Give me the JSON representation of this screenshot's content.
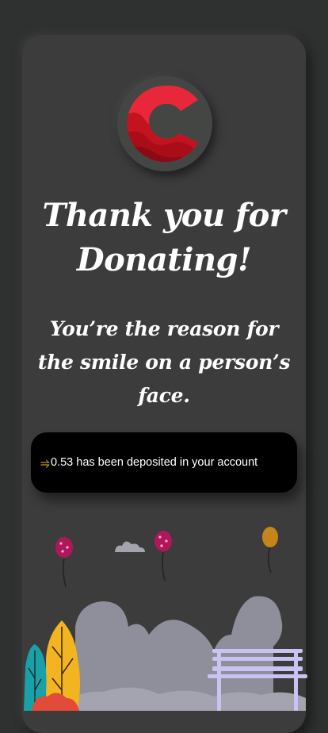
{
  "app": {
    "title_text": "Thank you for Donating!",
    "subtitle_text": "You’re the reason for the smile on a person’s face."
  },
  "notice": {
    "icon": "⥤",
    "message": "0.53 has been deposited in your account"
  },
  "colors": {
    "background": "#2f3030",
    "card": "#3b3c3b",
    "logo_red": "#d81e2c",
    "notice_bg": "#000000",
    "arrow": "#f4b63f"
  },
  "icons": [
    "brand-logo",
    "swap-arrow-icon",
    "balloon-illustration",
    "cloud-illustration",
    "tree-illustration",
    "bench-illustration"
  ]
}
